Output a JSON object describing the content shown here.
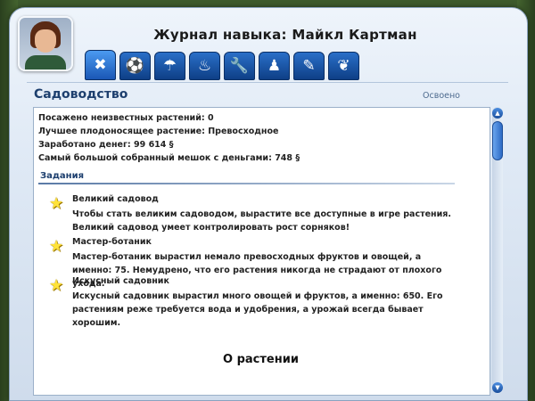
{
  "window": {
    "title": "Журнал навыка: Майкл Картман"
  },
  "tabs": [
    {
      "icon": "crossed-tools-icon",
      "glyph": "✖",
      "active": true
    },
    {
      "icon": "soccer-ball-icon",
      "glyph": "⚽",
      "active": false
    },
    {
      "icon": "watering-can-icon",
      "glyph": "☂",
      "active": false
    },
    {
      "icon": "chef-hat-icon",
      "glyph": "♨",
      "active": false
    },
    {
      "icon": "wrench-icon",
      "glyph": "🔧",
      "active": false
    },
    {
      "icon": "chess-pawn-icon",
      "glyph": "♟",
      "active": false
    },
    {
      "icon": "notepad-pencil-icon",
      "glyph": "✎",
      "active": false
    },
    {
      "icon": "butterfly-icon",
      "glyph": "❦",
      "active": false
    }
  ],
  "skill": {
    "name": "Садоводство",
    "status": "Освоено"
  },
  "stats": [
    "Посажено неизвестных растений: 0",
    "Лучшее плодоносящее растение: Превосходное",
    "Заработано денег: 99 614 §",
    "Самый большой собранный мешок с деньгами: 748 §"
  ],
  "tasks_heading": "Задания",
  "tasks": [
    {
      "title": "Великий садовод",
      "description": "Чтобы стать великим садоводом, вырастите все доступные в игре растения. Великий садовод умеет контролировать рост сорняков!"
    },
    {
      "title": "Мастер-ботаник",
      "description": "Мастер-ботаник вырастил немало превосходных фруктов и овощей, а именно: 75. Немудрено, что его растения никогда не страдают от плохого ухода."
    },
    {
      "title": "Искусный садовник",
      "description": "Искусный садовник вырастил много овощей и фруктов, а именно: 650. Его растениям реже требуется вода и удобрения, а урожай всегда бывает хорошим."
    }
  ],
  "about_button": "О растении",
  "colors": {
    "tab_blue": "#1a57b5",
    "title_blue": "#1d3f6e",
    "star_yellow": "#ffe23a"
  }
}
